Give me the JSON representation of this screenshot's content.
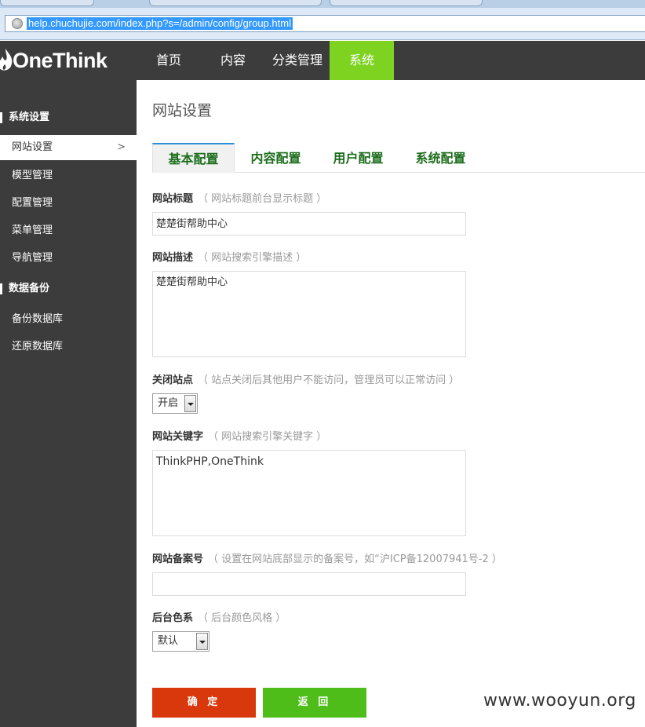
{
  "browser": {
    "url": "help.chuchujie.com/index.php?s=/admin/config/group.html"
  },
  "brand": {
    "logo_text": "OneThink"
  },
  "topnav": {
    "items": [
      {
        "label": "首页"
      },
      {
        "label": "内容"
      },
      {
        "label": "分类管理"
      },
      {
        "label": "系统",
        "active": true
      }
    ],
    "active_color": "#7ed321"
  },
  "sidebar": {
    "sections": [
      {
        "title": "系统设置",
        "items": [
          {
            "label": "网站设置",
            "active": true
          },
          {
            "label": "模型管理"
          },
          {
            "label": "配置管理"
          },
          {
            "label": "菜单管理"
          },
          {
            "label": "导航管理"
          }
        ]
      },
      {
        "title": "数据备份",
        "items": [
          {
            "label": "备份数据库"
          },
          {
            "label": "还原数据库"
          }
        ]
      }
    ]
  },
  "main": {
    "title": "网站设置",
    "tabs": [
      {
        "label": "基本配置",
        "active": true
      },
      {
        "label": "内容配置"
      },
      {
        "label": "用户配置"
      },
      {
        "label": "系统配置"
      }
    ],
    "fields": {
      "site_title": {
        "label": "网站标题",
        "hint": "（ 网站标题前台显示标题 ）",
        "value": "楚楚街帮助中心"
      },
      "site_desc": {
        "label": "网站描述",
        "hint": "（ 网站搜索引擎描述 ）",
        "value": "楚楚街帮助中心"
      },
      "site_close": {
        "label": "关闭站点",
        "hint": "（ 站点关闭后其他用户不能访问，管理员可以正常访问 ）",
        "value": "开启"
      },
      "site_keywords": {
        "label": "网站关键字",
        "hint": "（ 网站搜索引擎关键字 ）",
        "value": "ThinkPHP,OneThink"
      },
      "site_icp": {
        "label": "网站备案号",
        "hint": "（ 设置在网站底部显示的备案号，如“沪ICP备12007941号-2 ）",
        "value": ""
      },
      "admin_color": {
        "label": "后台色系",
        "hint": "（ 后台颜色风格 ）",
        "value": "默认"
      }
    },
    "buttons": {
      "confirm": "确 定",
      "back": "返 回"
    }
  },
  "watermark": "www.wooyun.org",
  "colors": {
    "confirm": "#d8380c",
    "back": "#4ebd1a",
    "tab_text": "#1c6d1c",
    "dark_bg": "#3c3c3c"
  }
}
